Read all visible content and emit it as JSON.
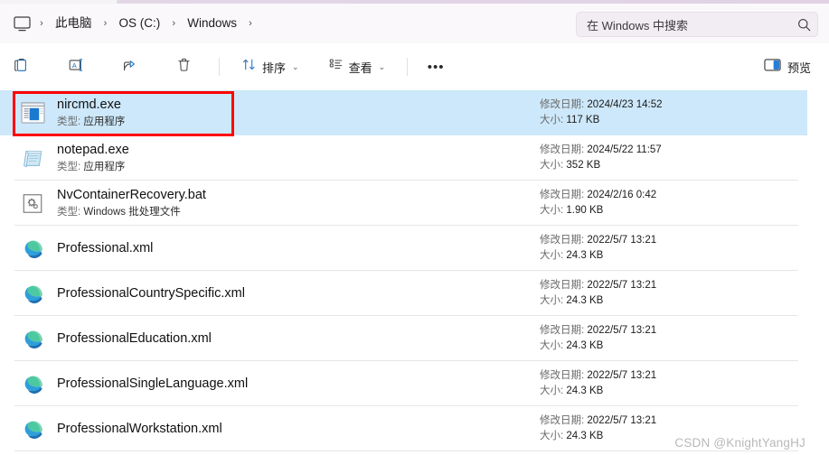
{
  "addressbar": {
    "device_icon": "monitor-icon",
    "crumbs": [
      {
        "label": "此电脑"
      },
      {
        "label": "OS (C:)"
      },
      {
        "label": "Windows"
      }
    ],
    "separator": "›",
    "search": {
      "placeholder": "在 Windows 中搜索",
      "icon": "search-icon"
    }
  },
  "toolbar": {
    "buttons": [
      {
        "name": "copy-button",
        "icon": "copy-icon",
        "label": ""
      },
      {
        "name": "rename-button",
        "icon": "rename-icon",
        "label": ""
      },
      {
        "name": "share-button",
        "icon": "share-icon",
        "label": ""
      },
      {
        "name": "delete-button",
        "icon": "trash-icon",
        "label": ""
      }
    ],
    "sort_label": "排序",
    "view_label": "查看",
    "more_label": "•••",
    "preview_label": "预览",
    "chevron": "⌄"
  },
  "list": {
    "date_key": "修改日期:",
    "size_key": "大小:",
    "type_key": "类型:",
    "rows": [
      {
        "name": "nircmd.exe",
        "type": "应用程序",
        "date": "2024/4/23 14:52",
        "size": "117 KB",
        "icon": "application-window-icon",
        "selected": true,
        "highlighted": true
      },
      {
        "name": "notepad.exe",
        "type": "应用程序",
        "date": "2024/5/22 11:57",
        "size": "352 KB",
        "icon": "notepad-icon",
        "selected": false,
        "highlighted": false
      },
      {
        "name": "NvContainerRecovery.bat",
        "type": "Windows 批处理文件",
        "date": "2024/2/16 0:42",
        "size": "1.90 KB",
        "icon": "batch-file-icon",
        "selected": false,
        "highlighted": false
      },
      {
        "name": "Professional.xml",
        "type": "",
        "date": "2022/5/7 13:21",
        "size": "24.3 KB",
        "icon": "edge-icon",
        "selected": false,
        "highlighted": false
      },
      {
        "name": "ProfessionalCountrySpecific.xml",
        "type": "",
        "date": "2022/5/7 13:21",
        "size": "24.3 KB",
        "icon": "edge-icon",
        "selected": false,
        "highlighted": false
      },
      {
        "name": "ProfessionalEducation.xml",
        "type": "",
        "date": "2022/5/7 13:21",
        "size": "24.3 KB",
        "icon": "edge-icon",
        "selected": false,
        "highlighted": false
      },
      {
        "name": "ProfessionalSingleLanguage.xml",
        "type": "",
        "date": "2022/5/7 13:21",
        "size": "24.3 KB",
        "icon": "edge-icon",
        "selected": false,
        "highlighted": false
      },
      {
        "name": "ProfessionalWorkstation.xml",
        "type": "",
        "date": "2022/5/7 13:21",
        "size": "24.3 KB",
        "icon": "edge-icon",
        "selected": false,
        "highlighted": false
      }
    ]
  },
  "watermark": {
    "text": "CSDN @KnightYangHJ"
  },
  "colors": {
    "selection": "#cde8fa",
    "annotation": "#fe0000",
    "accent": "#0f6cbd",
    "addressbar_bg": "#faf8fb"
  }
}
